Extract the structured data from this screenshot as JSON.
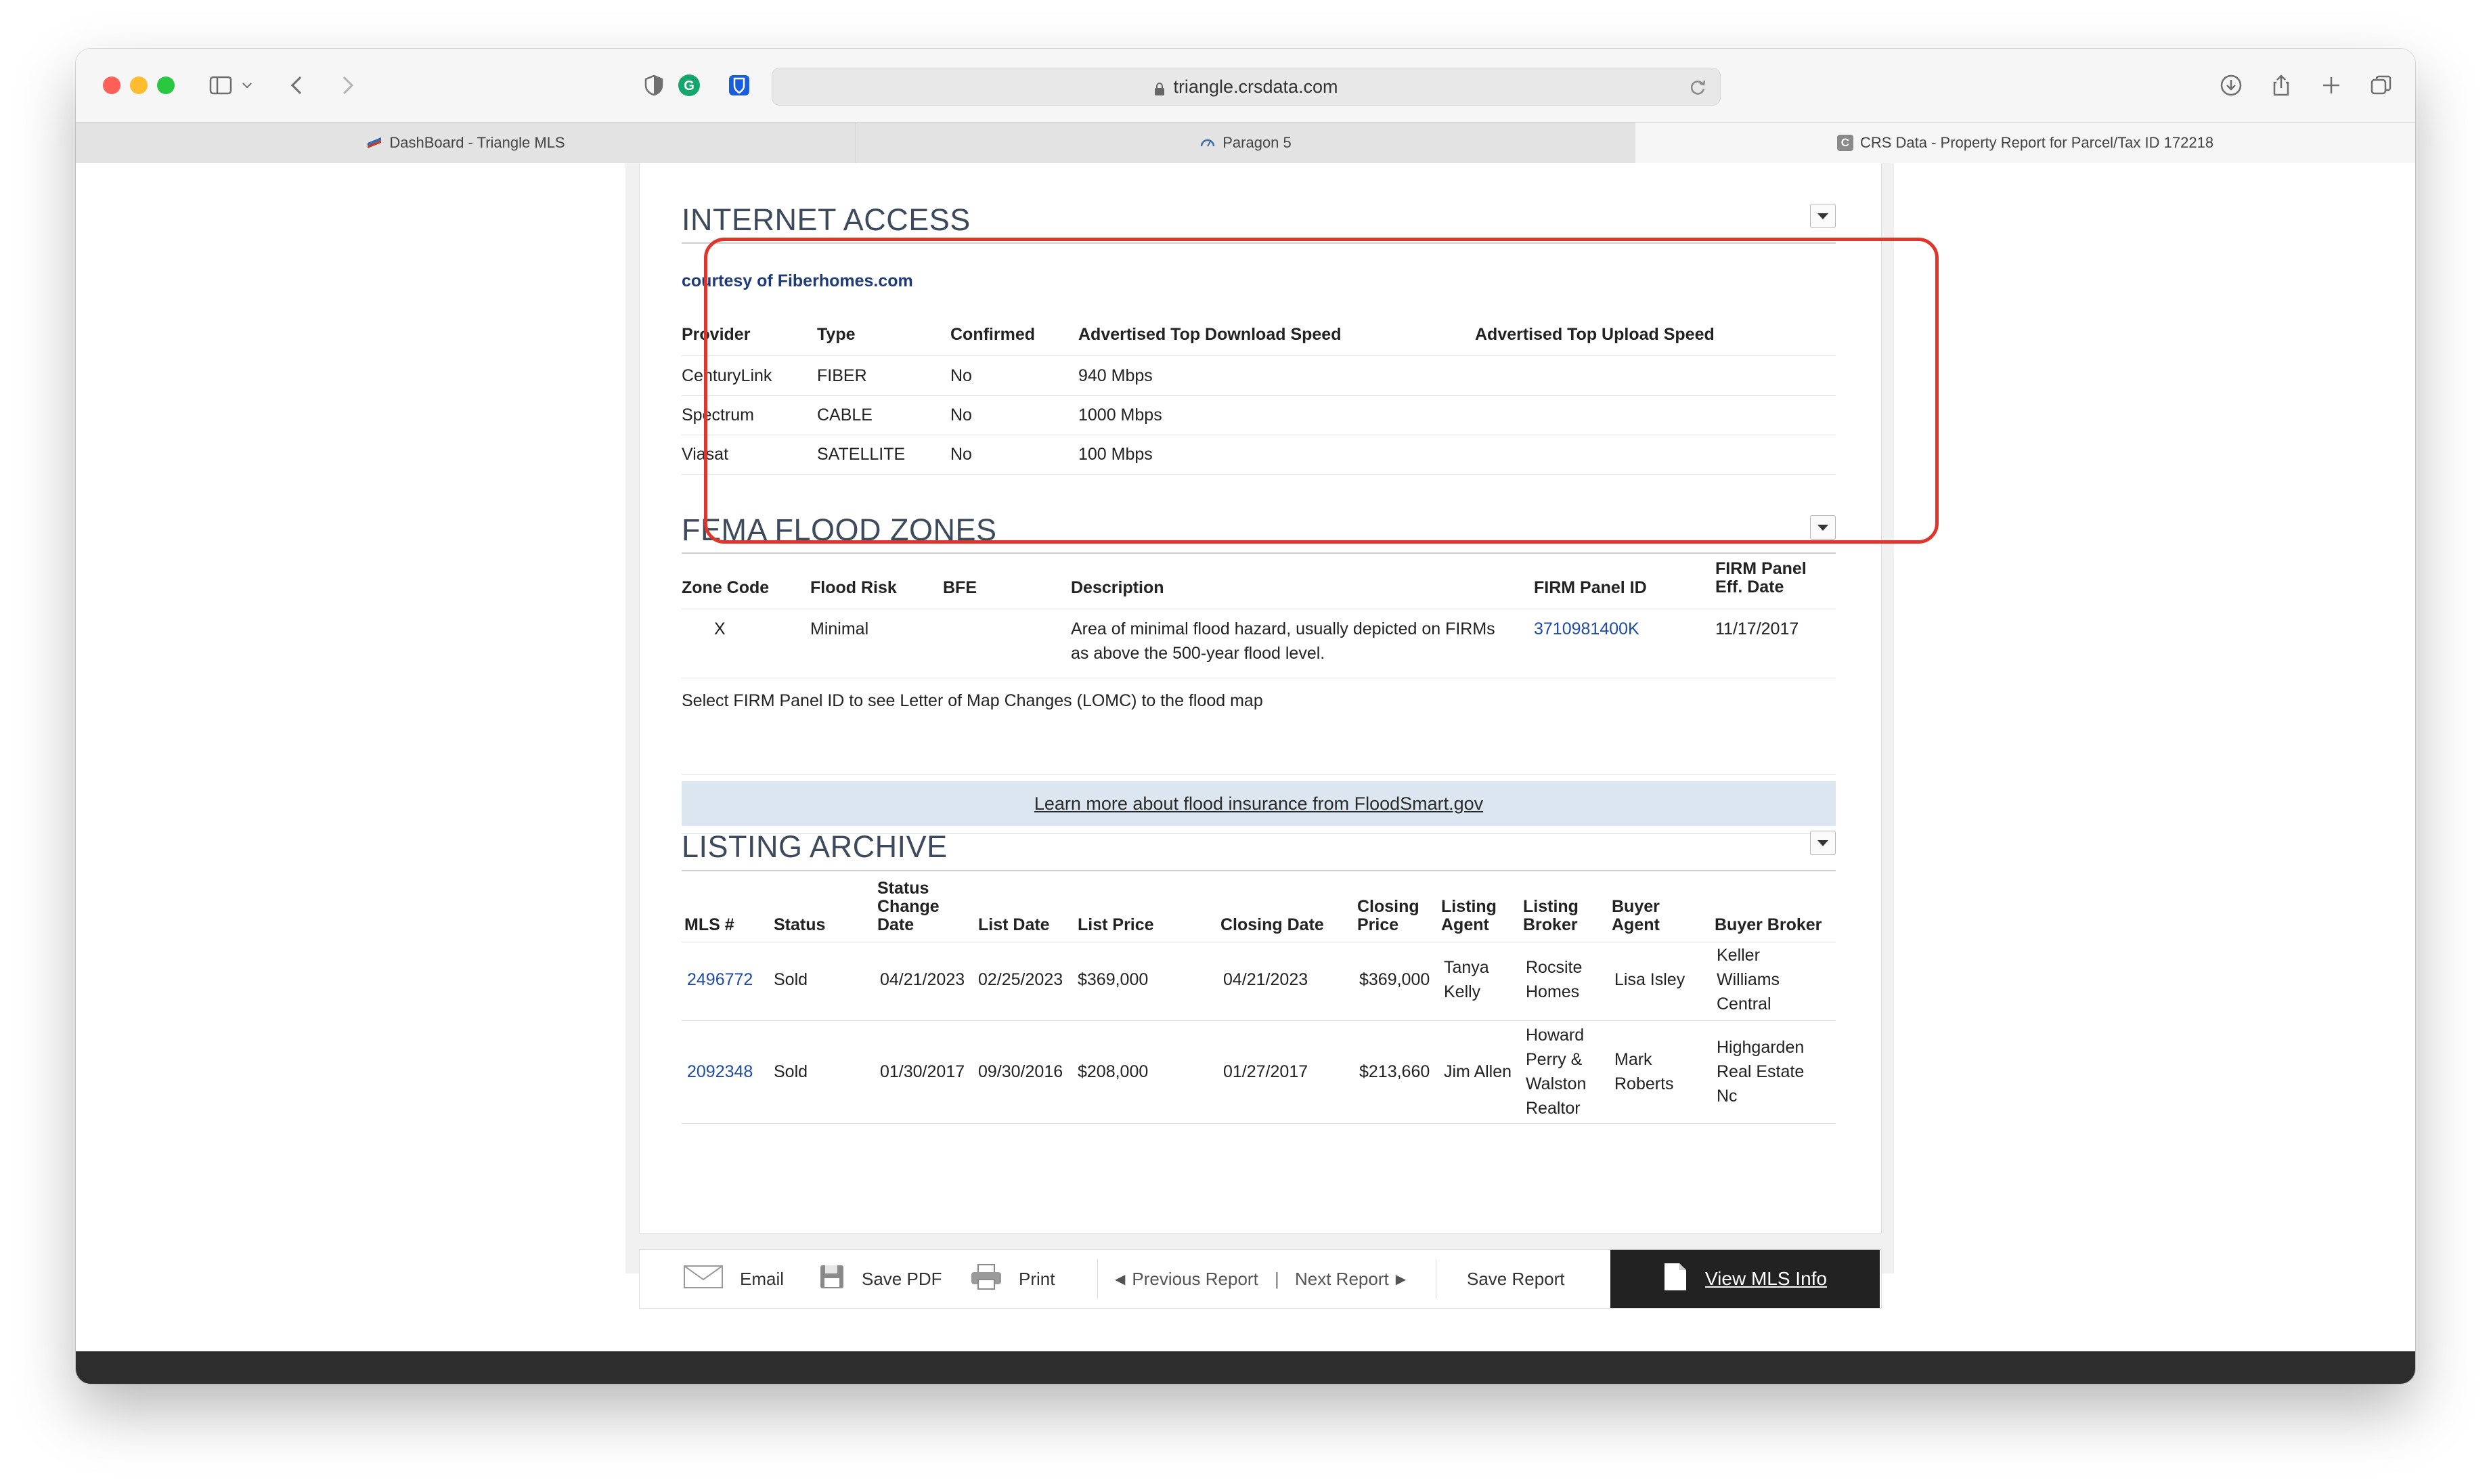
{
  "browser": {
    "url": "triangle.crsdata.com",
    "tabs": [
      {
        "label": "DashBoard - Triangle MLS"
      },
      {
        "label": "Paragon 5"
      },
      {
        "label": "CRS Data - Property Report for Parcel/Tax ID 172218"
      }
    ]
  },
  "internet_access": {
    "title": "INTERNET ACCESS",
    "courtesy": "courtesy of Fiberhomes.com",
    "headers": [
      "Provider",
      "Type",
      "Confirmed",
      "Advertised Top Download Speed",
      "Advertised Top Upload Speed"
    ],
    "rows": [
      {
        "provider": "CenturyLink",
        "type": "FIBER",
        "confirmed": "No",
        "download": "940 Mbps",
        "upload": ""
      },
      {
        "provider": "Spectrum",
        "type": "CABLE",
        "confirmed": "No",
        "download": "1000 Mbps",
        "upload": ""
      },
      {
        "provider": "Viasat",
        "type": "SATELLITE",
        "confirmed": "No",
        "download": "100 Mbps",
        "upload": ""
      }
    ]
  },
  "fema": {
    "title": "FEMA FLOOD ZONES",
    "headers": {
      "zone_code": "Zone Code",
      "flood_risk": "Flood Risk",
      "bfe": "BFE",
      "description": "Description",
      "panel_id": "FIRM Panel ID",
      "eff_date_1": "FIRM Panel",
      "eff_date_2": "Eff. Date"
    },
    "row": {
      "zone_code": "X",
      "flood_risk": "Minimal",
      "bfe": "",
      "description_1": "Area of minimal flood hazard, usually depicted on FIRMs",
      "description_2": "as above the 500-year flood level.",
      "panel_id": "3710981400K",
      "eff_date": "11/17/2017"
    },
    "note": "Select FIRM Panel ID to see Letter of Map Changes (LOMC) to the flood map",
    "floodsmart_link": "Learn more about flood insurance from FloodSmart.gov"
  },
  "listing_archive": {
    "title": "LISTING ARCHIVE",
    "headers": {
      "mls": "MLS #",
      "status": "Status",
      "status_change": [
        "Status",
        "Change",
        "Date"
      ],
      "list_date": "List Date",
      "list_price": "List Price",
      "closing_date": "Closing Date",
      "closing_price": [
        "Closing",
        "Price"
      ],
      "listing_agent": [
        "Listing",
        "Agent"
      ],
      "listing_broker": [
        "Listing",
        "Broker"
      ],
      "buyer_agent": [
        "Buyer",
        "Agent"
      ],
      "buyer_broker": "Buyer Broker"
    },
    "rows": [
      {
        "mls": "2496772",
        "status": "Sold",
        "status_change": "04/21/2023",
        "list_date": "02/25/2023",
        "list_price": "$369,000",
        "closing_date": "04/21/2023",
        "closing_price": "$369,000",
        "listing_agent": [
          "Tanya",
          "Kelly"
        ],
        "listing_broker": [
          "Rocsite",
          "Homes"
        ],
        "buyer_agent": [
          "Lisa Isley"
        ],
        "buyer_broker": [
          "Keller",
          "Williams",
          "Central"
        ]
      },
      {
        "mls": "2092348",
        "status": "Sold",
        "status_change": "01/30/2017",
        "list_date": "09/30/2016",
        "list_price": "$208,000",
        "closing_date": "01/27/2017",
        "closing_price": "$213,660",
        "listing_agent": [
          "Jim Allen"
        ],
        "listing_broker": [
          "Howard",
          "Perry &",
          "Walston",
          "Realtor"
        ],
        "buyer_agent": [
          "Mark",
          "Roberts"
        ],
        "buyer_broker": [
          "Highgarden",
          "Real Estate",
          "Nc"
        ]
      }
    ]
  },
  "footer": {
    "email": "Email",
    "save_pdf": "Save PDF",
    "print": "Print",
    "previous_report": "Previous Report",
    "divider": "|",
    "next_report": "Next Report",
    "save_report": "Save Report",
    "view_mls": "View MLS Info"
  },
  "colors": {
    "highlight": "#e0352b",
    "link": "#1e4aa8",
    "flood_bar": "#dce6f0"
  }
}
